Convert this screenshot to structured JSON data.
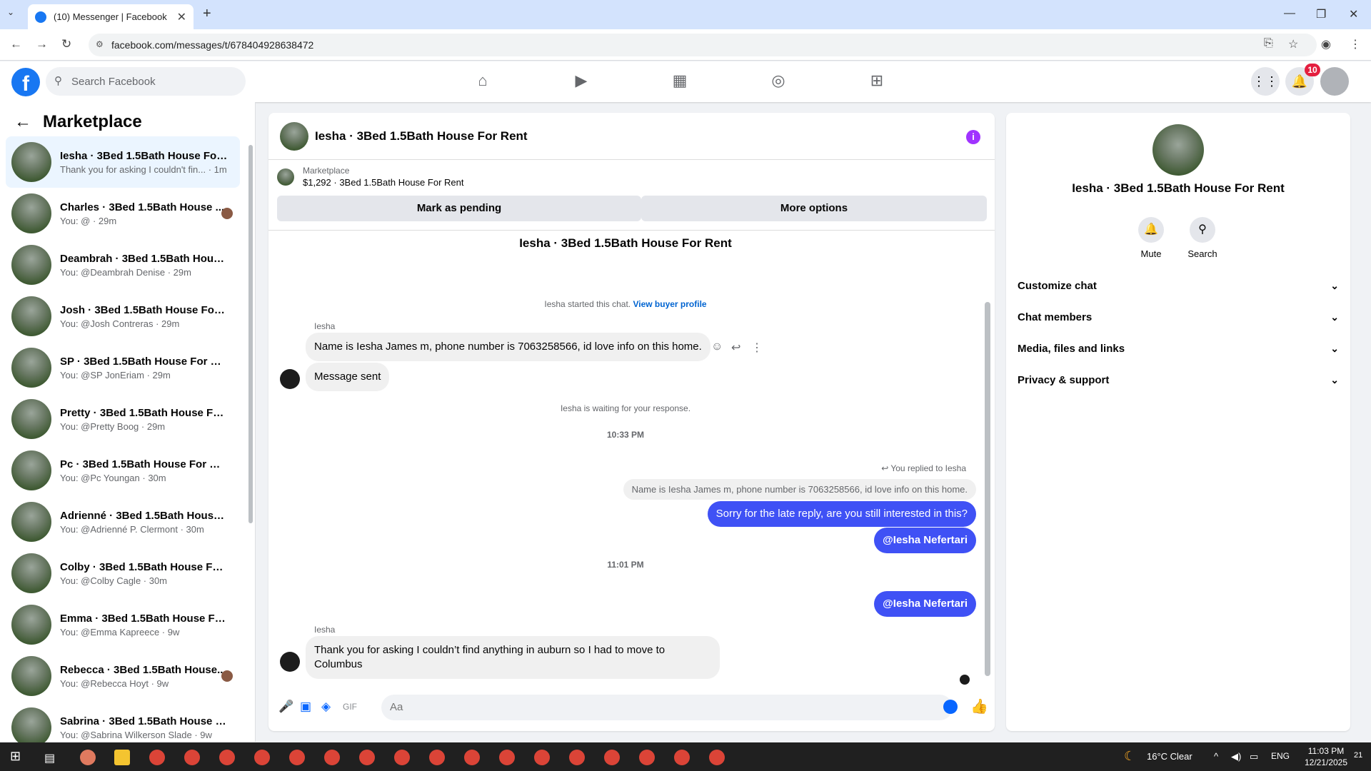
{
  "browser": {
    "tab_title": "(10) Messenger | Facebook",
    "url": "facebook.com/messages/t/678404928638472"
  },
  "fb": {
    "search_placeholder": "Search Facebook",
    "notif_count": "10"
  },
  "left": {
    "title": "Marketplace",
    "conversations": [
      {
        "name": "Iesha · 3Bed 1.5Bath House For ...",
        "sub": "Thank you for asking I couldn't fin... · 1m"
      },
      {
        "name": "Charles · 3Bed 1.5Bath House ...",
        "sub": "You: @ · 29m"
      },
      {
        "name": "Deambrah · 3Bed 1.5Bath House...",
        "sub": "You: @Deambrah Denise · 29m"
      },
      {
        "name": "Josh · 3Bed 1.5Bath House For R...",
        "sub": "You: @Josh Contreras · 29m"
      },
      {
        "name": "SP · 3Bed 1.5Bath House For Rent",
        "sub": "You: @SP JonEriam · 29m"
      },
      {
        "name": "Pretty · 3Bed 1.5Bath House For ...",
        "sub": "You: @Pretty Boog · 29m"
      },
      {
        "name": "Pc · 3Bed 1.5Bath House For Rent",
        "sub": "You: @Pc Youngan · 30m"
      },
      {
        "name": "Adrienné · 3Bed 1.5Bath House F...",
        "sub": "You: @Adrienné P. Clermont · 30m"
      },
      {
        "name": "Colby · 3Bed 1.5Bath House For ...",
        "sub": "You: @Colby Cagle · 30m"
      },
      {
        "name": "Emma · 3Bed 1.5Bath House For ...",
        "sub": "You: @Emma Kapreece · 9w"
      },
      {
        "name": "Rebecca · 3Bed 1.5Bath House...",
        "sub": "You: @Rebecca Hoyt · 9w"
      },
      {
        "name": "Sabrina · 3Bed 1.5Bath House Fo...",
        "sub": "You: @Sabrina Wilkerson Slade · 9w"
      }
    ]
  },
  "chat": {
    "header_title": "Iesha · 3Bed 1.5Bath House For Rent",
    "listing_label": "Marketplace",
    "listing_desc": "$1,292 · 3Bed 1.5Bath House For Rent",
    "mark_pending": "Mark as pending",
    "more_options": "More options",
    "convo_title": "Iesha · 3Bed 1.5Bath House For Rent",
    "started": "Iesha started this chat.",
    "view_profile": "View buyer profile",
    "sender1": "Iesha",
    "msg1": "Name is Iesha James m, phone number is 7063258566, id love info on this home.",
    "msg2": "Message sent",
    "waiting": "Iesha is waiting for your response.",
    "time1": "10:33 PM",
    "replied": "You replied to Iesha",
    "quote": "Name is Iesha James m, phone number is 7063258566, id love info on this home.",
    "out1": "Sorry for the late reply, are you still interested in this?",
    "out2": "@Iesha Nefertari",
    "time2": "11:01 PM",
    "out3": "@Iesha Nefertari",
    "sender2": "Iesha",
    "msg3": "Thank you for asking I couldn’t find anything in auburn so I had to move to Columbus",
    "input_placeholder": "Aa"
  },
  "right": {
    "name": "Iesha · 3Bed 1.5Bath House For Rent",
    "mute": "Mute",
    "search": "Search",
    "items": [
      "Customize chat",
      "Chat members",
      "Media, files and links",
      "Privacy & support"
    ]
  },
  "taskbar": {
    "weather": "16°C  Clear",
    "lang": "ENG",
    "time": "11:03 PM",
    "date": "12/21/2025",
    "notif": "21"
  },
  "colors": {
    "fb_blue": "#1877f2",
    "bubble_out": "#3f51f5",
    "info": "#a033ff"
  }
}
